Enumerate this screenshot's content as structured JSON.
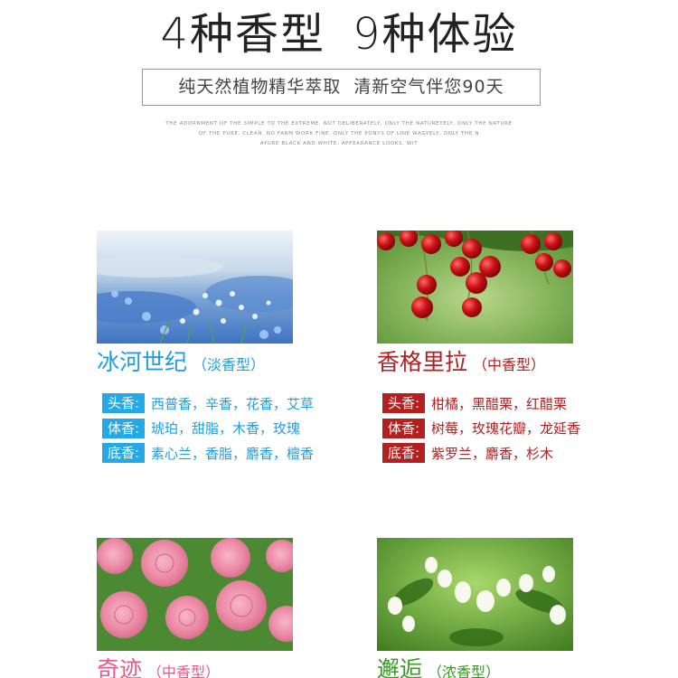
{
  "header": {
    "headline_left": "4种香型",
    "headline_right": "9种体验",
    "subtitle_left": "纯天然植物精华萃取",
    "subtitle_right": "清新空气伴您90天",
    "fine_print": [
      "THE ADORNMENT OF THE SIMPLE TO THE EXTREME. NOT DELIBERATELY, ONLY THE NATURETELY, ONLY THE NATURE",
      "OF THE PURE. CLEAN. NO FARM WORK FINE. ONLY THE PONYS OF LINE WAGYELY, ONLY THE N",
      "AYURE BLACK AND WHITE. APPEARANCE LOOKS. WIT"
    ]
  },
  "scents": [
    {
      "name": "冰河世纪",
      "type": "（淡香型）",
      "photo_icon": "blue-flower-field-photo",
      "accent": "#25a8e6",
      "notes": [
        {
          "tag": "头香:",
          "value": "西普香，辛香，花香，艾草"
        },
        {
          "tag": "体香:",
          "value": "琥珀，甜脂，木香，玫瑰"
        },
        {
          "tag": "底香:",
          "value": "素心兰，香脂，麝香，檀香"
        }
      ]
    },
    {
      "name": "香格里拉",
      "type": "（中香型）",
      "photo_icon": "red-currant-photo",
      "accent": "#b42020",
      "notes": [
        {
          "tag": "头香:",
          "value": "柑橘，黑醋栗，红醋栗"
        },
        {
          "tag": "体香:",
          "value": "树莓，玫瑰花瓣，龙延香"
        },
        {
          "tag": "底香:",
          "value": "紫罗兰，麝香，杉木"
        }
      ]
    },
    {
      "name": "奇迹",
      "type": "（中香型）",
      "photo_icon": "pink-rose-photo",
      "accent": "#e45b8a"
    },
    {
      "name": "邂逅",
      "type": "（浓香型）",
      "photo_icon": "jasmine-photo",
      "accent": "#3b9a26"
    }
  ]
}
